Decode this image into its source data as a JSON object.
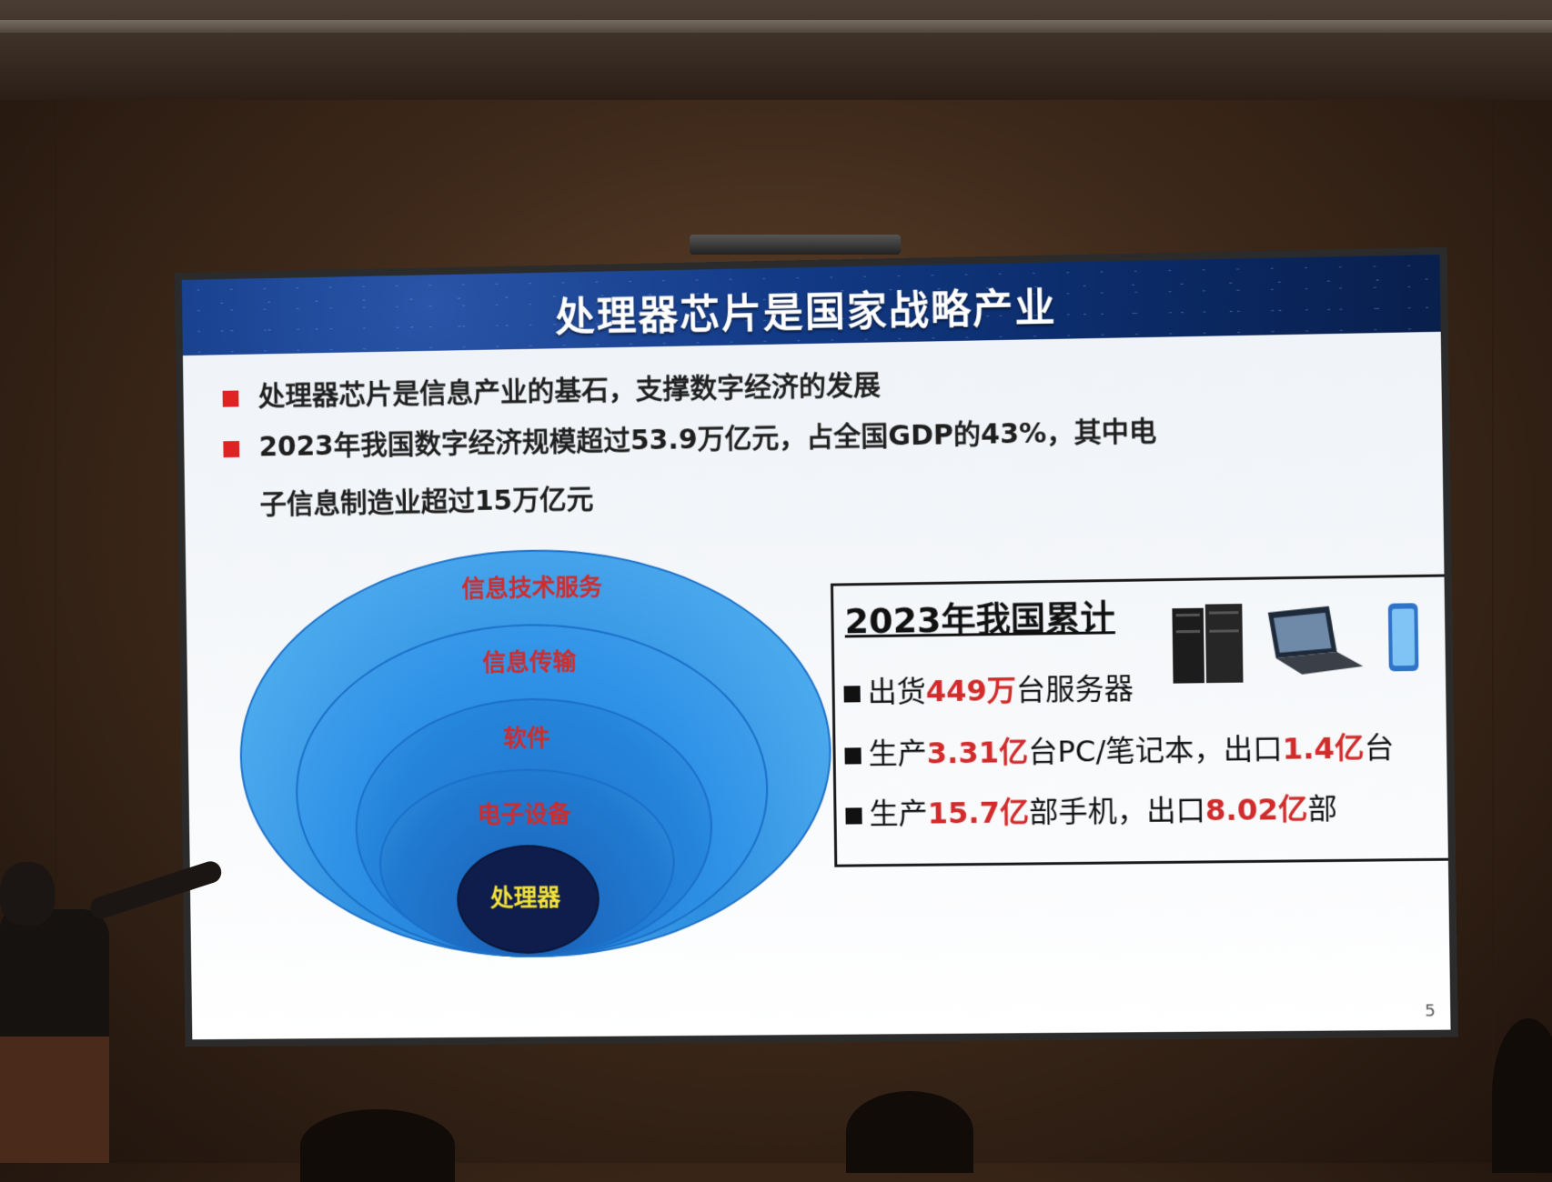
{
  "slide": {
    "title": "处理器芯片是国家战略产业",
    "bullets": [
      "处理器芯片是信息产业的基石，支撑数字经济的发展",
      "2023年我国数字经济规模超过53.9万亿元，占全国GDP的43%，其中电"
    ],
    "bullet2_continuation": "子信息制造业超过15万亿元",
    "rings": [
      "信息技术服务",
      "信息传输",
      "软件",
      "电子设备",
      "处理器"
    ],
    "stats": {
      "heading": "2023年我国累计",
      "line1": {
        "a": "出货",
        "b": "449万",
        "c": "台服务器"
      },
      "line2": {
        "a": "生产",
        "b": "3.31亿",
        "c": "台PC/笔记本，出口",
        "d": "1.4亿",
        "e": "台"
      },
      "line3": {
        "a": "生产",
        "b": "15.7亿",
        "c": "部手机，出口",
        "d": "8.02亿",
        "e": "部"
      }
    },
    "page_number": "5"
  }
}
